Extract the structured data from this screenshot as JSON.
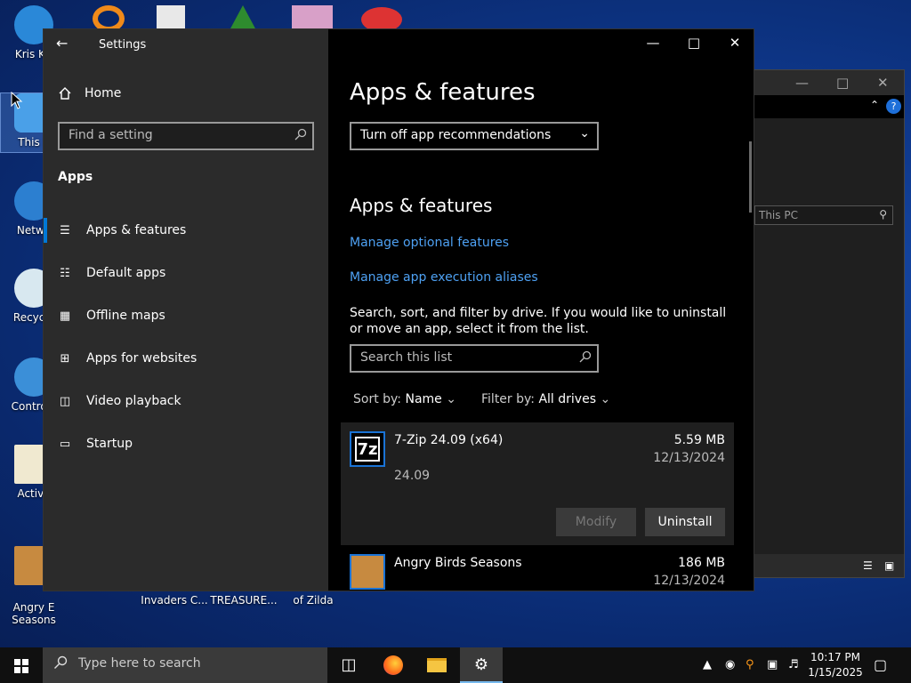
{
  "desktop": {
    "icons": [
      {
        "label": "Kris Kri",
        "color": "#2a88d8"
      },
      {
        "label": "This P",
        "color": "#4aa0e8"
      },
      {
        "label": "Netwo",
        "color": "#2c7fd0"
      },
      {
        "label": "Recycle",
        "color": "#d8e8f0"
      },
      {
        "label": "Control I",
        "color": "#3b8fd8"
      },
      {
        "label": "Activa",
        "color": "#f0e9d0"
      },
      {
        "label": "Angry E\nSeasons",
        "color": "#c78a40"
      }
    ],
    "bottom_labels": [
      "Invaders C...",
      "TREASURE...",
      "of Zilda"
    ]
  },
  "bg_window": {
    "search_placeholder": "This PC"
  },
  "settings": {
    "title": "Settings",
    "nav": {
      "home": "Home",
      "find_placeholder": "Find a setting",
      "section": "Apps",
      "items": [
        {
          "label": "Apps & features",
          "icon": "list-icon"
        },
        {
          "label": "Default apps",
          "icon": "default-apps-icon"
        },
        {
          "label": "Offline maps",
          "icon": "map-icon"
        },
        {
          "label": "Apps for websites",
          "icon": "link-window-icon"
        },
        {
          "label": "Video playback",
          "icon": "video-icon"
        },
        {
          "label": "Startup",
          "icon": "startup-icon"
        }
      ]
    },
    "main": {
      "heading": "Apps & features",
      "recommendation_select": "Turn off app recommendations",
      "subheading": "Apps & features",
      "link_optional": "Manage optional features",
      "link_aliases": "Manage app execution aliases",
      "description": "Search, sort, and filter by drive. If you would like to uninstall or move an app, select it from the list.",
      "search_placeholder": "Search this list",
      "sort_label": "Sort by:",
      "sort_value": "Name",
      "filter_label": "Filter by:",
      "filter_value": "All drives",
      "apps": [
        {
          "name": "7-Zip 24.09 (x64)",
          "size": "5.59 MB",
          "date": "12/13/2024",
          "version": "24.09",
          "modify": "Modify",
          "uninstall": "Uninstall"
        },
        {
          "name": "Angry Birds Seasons",
          "size": "186 MB",
          "date": "12/13/2024"
        }
      ]
    }
  },
  "taskbar": {
    "search_placeholder": "Type here to search",
    "time": "10:17 PM",
    "date": "1/15/2025"
  },
  "colors": {
    "accent": "#0078d7",
    "link": "#4ea1f3",
    "nav_bg": "#2b2b2b",
    "content_bg": "#000000"
  }
}
